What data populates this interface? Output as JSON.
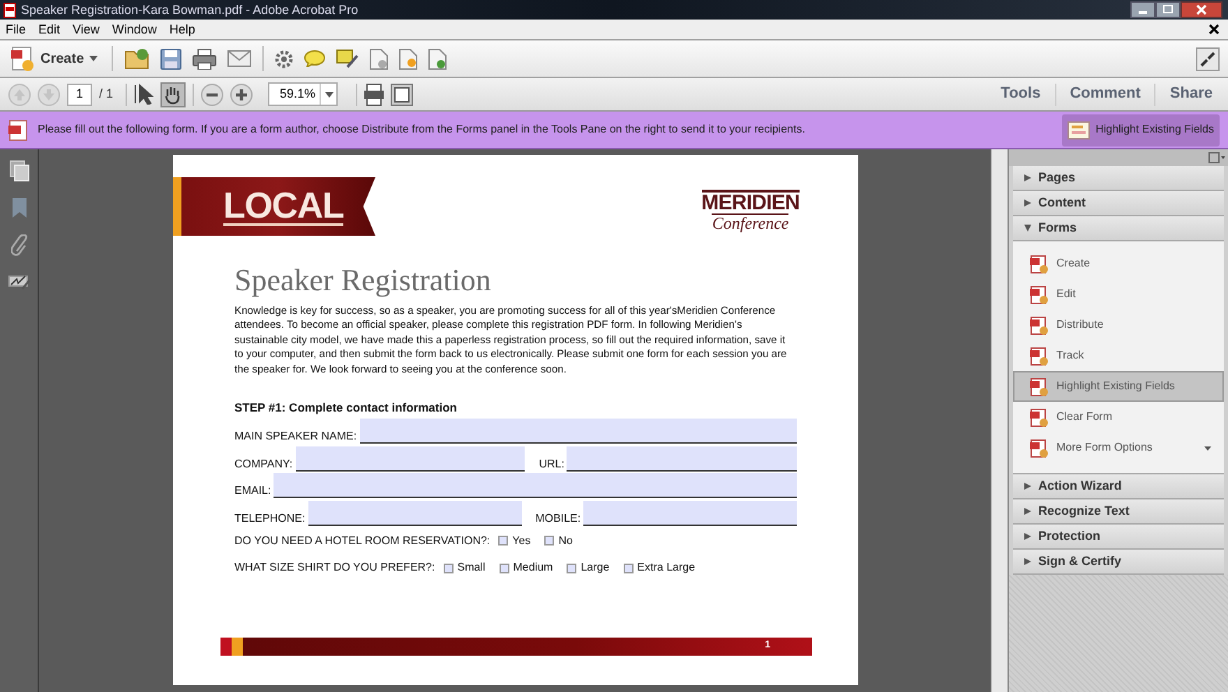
{
  "window": {
    "title": "Speaker Registration-Kara Bowman.pdf - Adobe Acrobat Pro"
  },
  "menu": [
    "File",
    "Edit",
    "View",
    "Window",
    "Help"
  ],
  "toolbar": {
    "create": "Create"
  },
  "navigation": {
    "page": "1",
    "page_total": "/ 1",
    "zoom": "59.1%"
  },
  "task_tabs": [
    "Tools",
    "Comment",
    "Share"
  ],
  "message_bar": {
    "text": "Please fill out the following form. If you are a form author, choose Distribute from the Forms panel in the Tools Pane on the right to send it to your recipients.",
    "button": "Highlight Existing Fields"
  },
  "document": {
    "banner": "LOCAL",
    "logo": {
      "name": "MERIDIEN",
      "tagline": "Conference"
    },
    "title": "Speaker Registration",
    "intro": "Knowledge is key for success, so as a speaker, you are promoting success for all of this year'sMeridien Conference attendees. To become an official speaker, please complete this registration PDF form. In following Meridien's sustainable city model, we have made this a paperless registration process, so fill out the required information, save it to your computer, and then submit the form back to us electronically. Please submit one form for each session you are the speaker for. We look forward to seeing you at the conference soon.",
    "step_heading": "STEP #1: Complete contact information",
    "field_rows": [
      [
        {
          "label": "MAIN SPEAKER NAME:"
        }
      ],
      [
        {
          "label": "COMPANY:"
        },
        {
          "label": "URL:"
        }
      ],
      [
        {
          "label": "EMAIL:"
        }
      ],
      [
        {
          "label": "TELEPHONE:"
        },
        {
          "label": "MOBILE:"
        }
      ]
    ],
    "questions": [
      {
        "question": "DO YOU NEED A HOTEL ROOM RESERVATION?:",
        "options": [
          {
            "label": "Yes",
            "checked": false
          },
          {
            "label": "No",
            "checked": false
          }
        ]
      },
      {
        "question": "WHAT SIZE SHIRT DO YOU PREFER?:",
        "options": [
          {
            "label": "Small",
            "checked": false
          },
          {
            "label": "Medium",
            "checked": false
          },
          {
            "label": "Large",
            "checked": false
          },
          {
            "label": "Extra Large",
            "checked": false
          }
        ]
      }
    ],
    "page_number": "1"
  },
  "tools_pane": {
    "sections": [
      {
        "label": "Pages",
        "expanded": false
      },
      {
        "label": "Content",
        "expanded": false
      },
      {
        "label": "Forms",
        "expanded": true,
        "items": [
          {
            "label": "Create",
            "selected": false
          },
          {
            "label": "Edit",
            "selected": false
          },
          {
            "label": "Distribute",
            "selected": false
          },
          {
            "label": "Track",
            "selected": false
          },
          {
            "label": "Highlight Existing Fields",
            "selected": true
          },
          {
            "label": "Clear Form",
            "selected": false
          },
          {
            "label": "More Form Options",
            "selected": false,
            "dropdown": true
          }
        ]
      },
      {
        "label": "Action Wizard",
        "expanded": false
      },
      {
        "label": "Recognize Text",
        "expanded": false
      },
      {
        "label": "Protection",
        "expanded": false
      },
      {
        "label": "Sign & Certify",
        "expanded": false
      }
    ]
  }
}
